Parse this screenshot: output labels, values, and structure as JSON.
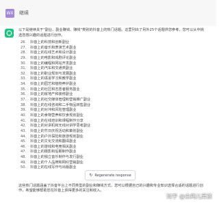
{
  "user": {
    "avatar_text": "WX",
    "message": "继续"
  },
  "assistant": {
    "intro": "以下是继续关于\"副业、副业赚钱、赚钱\"类别的抖音上的热门话题。这里列出了另外25个话题供您参考，您可以从中挑选您感兴趣的话题进行创作。",
    "list": [
      {
        "num": "26.",
        "text": "抖音上的科技和创新副业"
      },
      {
        "num": "27.",
        "text": "抖音上的音乐和表演艺术副业"
      },
      {
        "num": "28.",
        "text": "抖音上的在线艺术和设计副业"
      },
      {
        "num": "29.",
        "text": "抖音上的电影和戏剧评论副业"
      },
      {
        "num": "30.",
        "text": "抖音上的编程和网站开发副业"
      },
      {
        "num": "31.",
        "text": "抖音上的汽车和交通类副业"
      },
      {
        "num": "32.",
        "text": "抖音上的职业规划与发展副业"
      },
      {
        "num": "33.",
        "text": "抖音上的语言学习和教学副业"
      },
      {
        "num": "34.",
        "text": "抖音上的园艺和植物养护副业"
      },
      {
        "num": "35.",
        "text": "抖音上的社区和志愿者服务副业"
      },
      {
        "num": "36.",
        "text": "抖音上的房地产和装修副业"
      },
      {
        "num": "37.",
        "text": "抖音上的社交媒体管理和营销推广副业"
      },
      {
        "num": "38.",
        "text": "抖音上的在线咨询和二手物品转售副业"
      },
      {
        "num": "39.",
        "text": "抖音上的对冲和风险管理副业"
      },
      {
        "num": "40.",
        "text": "抖音上的食物营养和饮食规划副业"
      },
      {
        "num": "41.",
        "text": "抖音上的在线培训和课程制作分享"
      },
      {
        "num": "42.",
        "text": "抖音上的对讲机和无线对讲学思考副业"
      },
      {
        "num": "43.",
        "text": "抖音上的节日庆祝活动和策划副业"
      },
      {
        "num": "44.",
        "text": "抖音上的户外探险和旅游规划副业"
      },
      {
        "num": "45.",
        "text": "抖音上的文化交流和翻译副业"
      },
      {
        "num": "46.",
        "text": "抖音上的游戏和电竞相关副业"
      },
      {
        "num": "47.",
        "text": "抖音上的摄影和后期制作副业"
      },
      {
        "num": "48.",
        "text": "抖音上的独立音乐制作与发行副业"
      },
      {
        "num": "49.",
        "text": "抖音上的个人品牌和网红营销副业"
      },
      {
        "num": "50.",
        "text": "抖音上的在线写作与出版副业"
      }
    ],
    "outro": "这些热门话题涵盖了抖音平台上不同类型的副业和赚钱方式，您可以根据自己的兴趣和专业知识选择合适的话题进行创作，希望能够帮助您在抖音上获得更多的关注和收入。"
  },
  "regenerate": {
    "label": "Regenerate response",
    "icon": "refresh-icon"
  },
  "watermark": "知乎 @白鸽儿男孩",
  "colors": {
    "bot_avatar": "#19c37d",
    "user_avatar": "#a28bd4",
    "header_bg": "#f7f7f8"
  }
}
